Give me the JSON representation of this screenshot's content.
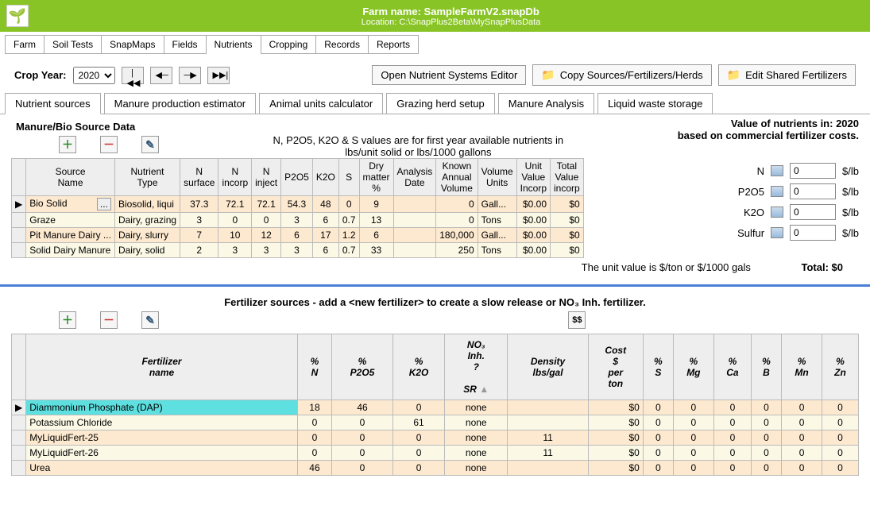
{
  "header": {
    "farm_label": "Farm name:",
    "farm": "SampleFarmV2.snapDb",
    "loc_label": "Location:",
    "loc": "C:\\SnapPlus2Beta\\MySnapPlusData"
  },
  "menu": [
    "Farm",
    "Soil Tests",
    "SnapMaps",
    "Fields",
    "Nutrients",
    "Cropping",
    "Records",
    "Reports"
  ],
  "menu_active": 4,
  "toolbar": {
    "crop_year_label": "Crop Year:",
    "crop_year": "2020",
    "open_editor": "Open Nutrient Systems Editor",
    "copy": "Copy Sources/Fertilizers/Herds",
    "edit_shared": "Edit Shared Fertilizers"
  },
  "subtabs": [
    "Nutrient sources",
    "Manure production estimator",
    "Animal units calculator",
    "Grazing herd setup",
    "Manure Analysis",
    "Liquid waste storage"
  ],
  "subtab_active": 0,
  "manure": {
    "title": "Manure/Bio Source Data",
    "note1": "N, P2O5, K2O & S values are for first year available nutrients in",
    "note2": "lbs/unit solid    or    lbs/1000 gallons",
    "headers": [
      "Source Name",
      "Nutrient Type",
      "N surface",
      "N incorp",
      "N inject",
      "P2O5",
      "K2O",
      "S",
      "Dry matter %",
      "Analysis Date",
      "Known Annual Volume",
      "Volume Units",
      "Unit Value Incorp",
      "Total Value incorp"
    ],
    "rows": [
      {
        "name": "Bio Solid",
        "type": "Biosolid, liqui",
        "nsurf": "37.3",
        "ninc": "72.1",
        "ninj": "72.1",
        "p": "54.3",
        "k": "48",
        "s": "0",
        "dm": "9",
        "date": "",
        "vol": "0",
        "units": "Gall...",
        "uval": "$0.00",
        "tval": "$0"
      },
      {
        "name": "Graze",
        "type": "Dairy, grazing",
        "nsurf": "3",
        "ninc": "0",
        "ninj": "0",
        "p": "3",
        "k": "6",
        "s": "0.7",
        "dm": "13",
        "date": "",
        "vol": "0",
        "units": "Tons",
        "uval": "$0.00",
        "tval": "$0"
      },
      {
        "name": "Pit Manure Dairy ...",
        "type": "Dairy, slurry",
        "nsurf": "7",
        "ninc": "10",
        "ninj": "12",
        "p": "6",
        "k": "17",
        "s": "1.2",
        "dm": "6",
        "date": "",
        "vol": "180,000",
        "units": "Gall...",
        "uval": "$0.00",
        "tval": "$0"
      },
      {
        "name": "Solid Dairy Manure",
        "type": "Dairy, solid",
        "nsurf": "2",
        "ninc": "3",
        "ninj": "3",
        "p": "3",
        "k": "6",
        "s": "0.7",
        "dm": "33",
        "date": "",
        "vol": "250",
        "units": "Tons",
        "uval": "$0.00",
        "tval": "$0"
      }
    ],
    "unit_note": "The unit value is $/ton or $/1000 gals",
    "total_label": "Total:",
    "total": "$0"
  },
  "valuebox": {
    "line1": "Value of nutrients in: 2020",
    "line2": "based on commercial fertilizer costs."
  },
  "nutrients": [
    {
      "label": "N",
      "value": "0",
      "unit": "$/lb"
    },
    {
      "label": "P2O5",
      "value": "0",
      "unit": "$/lb"
    },
    {
      "label": "K2O",
      "value": "0",
      "unit": "$/lb"
    },
    {
      "label": "Sulfur",
      "value": "0",
      "unit": "$/lb"
    }
  ],
  "fert": {
    "title": "Fertilizer sources    -    add a <new fertilizer> to create a slow release or NO₃ Inh. fertilizer.",
    "dollar": "$$",
    "headers": [
      "Fertilizer name",
      "% N",
      "% P2O5",
      "% K2O",
      "NO₃ Inh. ?  SR",
      "Density lbs/gal",
      "Cost $ per ton",
      "% S",
      "% Mg",
      "% Ca",
      "% B",
      "% Mn",
      "% Zn"
    ],
    "rows": [
      {
        "name": "Diammonium Phosphate (DAP)",
        "n": "18",
        "p": "46",
        "k": "0",
        "inh": "none",
        "dens": "",
        "cost": "$0",
        "s": "0",
        "mg": "0",
        "ca": "0",
        "b": "0",
        "mn": "0",
        "zn": "0",
        "sel": true
      },
      {
        "name": "Potassium Chloride",
        "n": "0",
        "p": "0",
        "k": "61",
        "inh": "none",
        "dens": "",
        "cost": "$0",
        "s": "0",
        "mg": "0",
        "ca": "0",
        "b": "0",
        "mn": "0",
        "zn": "0"
      },
      {
        "name": "MyLiquidFert-25",
        "n": "0",
        "p": "0",
        "k": "0",
        "inh": "none",
        "dens": "11",
        "cost": "$0",
        "s": "0",
        "mg": "0",
        "ca": "0",
        "b": "0",
        "mn": "0",
        "zn": "0"
      },
      {
        "name": "MyLiquidFert-26",
        "n": "0",
        "p": "0",
        "k": "0",
        "inh": "none",
        "dens": "11",
        "cost": "$0",
        "s": "0",
        "mg": "0",
        "ca": "0",
        "b": "0",
        "mn": "0",
        "zn": "0"
      },
      {
        "name": "Urea",
        "n": "46",
        "p": "0",
        "k": "0",
        "inh": "none",
        "dens": "",
        "cost": "$0",
        "s": "0",
        "mg": "0",
        "ca": "0",
        "b": "0",
        "mn": "0",
        "zn": "0"
      }
    ]
  }
}
